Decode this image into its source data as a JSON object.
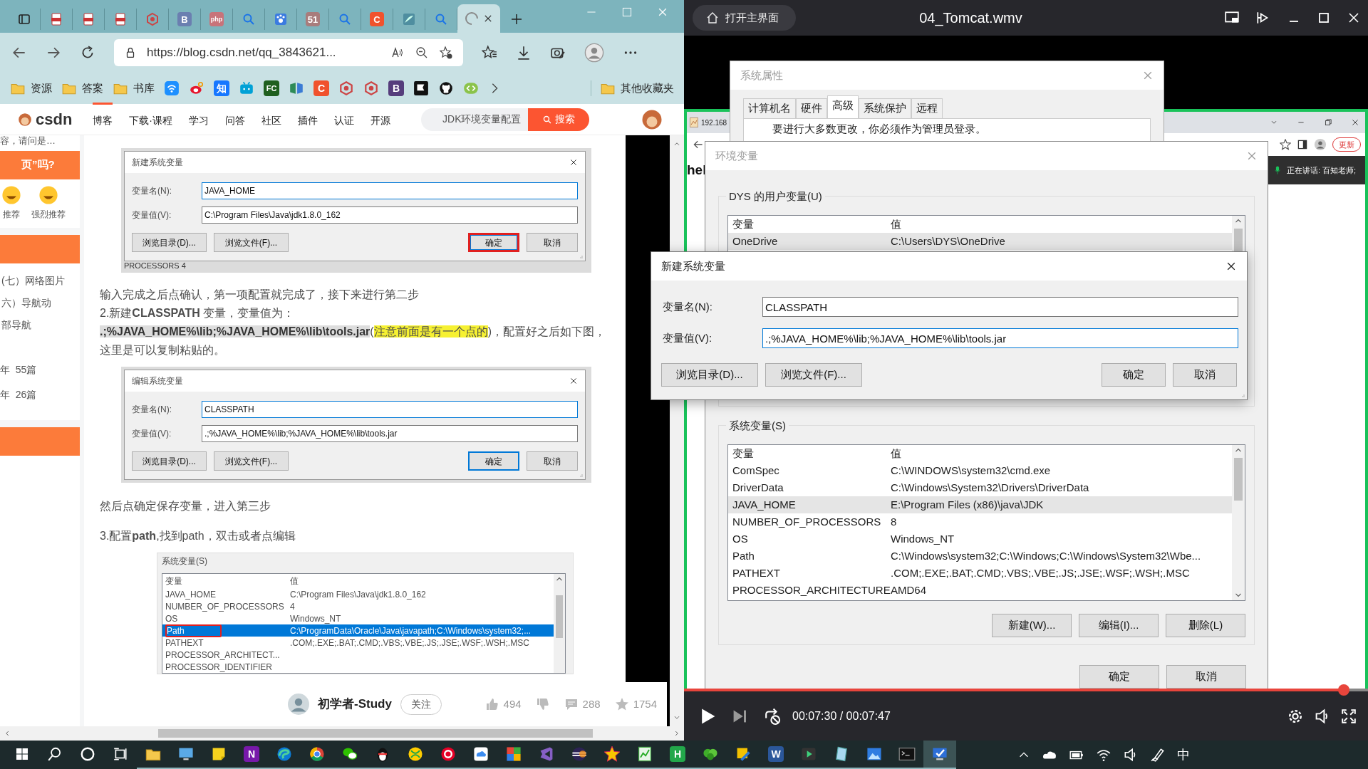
{
  "browser": {
    "tabs": [
      {
        "kind": "window",
        "selected": false
      },
      {
        "kind": "pdf",
        "selected": false
      },
      {
        "kind": "pdf",
        "selected": false
      },
      {
        "kind": "pdf",
        "selected": false
      },
      {
        "kind": "hexagon",
        "selected": false
      },
      {
        "kind": "letter",
        "glyph": "B",
        "color": "#6b7fb0",
        "selected": false
      },
      {
        "kind": "letter",
        "glyph": "php",
        "color": "#c8737a",
        "selected": false
      },
      {
        "kind": "search",
        "selected": false
      },
      {
        "kind": "paw",
        "selected": false
      },
      {
        "kind": "letter",
        "glyph": "51",
        "color": "#a87c7c",
        "selected": false
      },
      {
        "kind": "search",
        "selected": false
      },
      {
        "kind": "letter",
        "glyph": "C",
        "color": "#f0522d",
        "selected": false
      },
      {
        "kind": "leaf",
        "selected": false
      },
      {
        "kind": "search",
        "selected": false
      },
      {
        "kind": "loading",
        "selected": true
      }
    ],
    "address": "https://blog.csdn.net/qq_3843621...",
    "bookmarks": [
      {
        "kind": "folder",
        "label": "资源"
      },
      {
        "kind": "folder",
        "label": "答案"
      },
      {
        "kind": "folder",
        "label": "书库"
      },
      {
        "kind": "wifi"
      },
      {
        "kind": "eye"
      },
      {
        "kind": "letter",
        "glyph": "知",
        "color": "#1677ff"
      },
      {
        "kind": "tv"
      },
      {
        "kind": "letter",
        "glyph": "FC",
        "color": "#1f5f1f"
      },
      {
        "kind": "book"
      },
      {
        "kind": "letter",
        "glyph": "C",
        "color": "#f0522d"
      },
      {
        "kind": "hexagon"
      },
      {
        "kind": "hexagon"
      },
      {
        "kind": "letter",
        "glyph": "B",
        "color": "#563d7c"
      },
      {
        "kind": "flag"
      },
      {
        "kind": "cat"
      },
      {
        "kind": "code"
      }
    ],
    "other_bookmarks": "其他收藏夹"
  },
  "site": {
    "logo": "csdn",
    "nav": [
      {
        "label": "博客",
        "selected": true
      },
      {
        "label": "下载·课程",
        "selected": false
      },
      {
        "label": "学习",
        "selected": false
      },
      {
        "label": "问答",
        "selected": false
      },
      {
        "label": "社区",
        "selected": false
      },
      {
        "label": "插件",
        "selected": false
      },
      {
        "label": "认证",
        "selected": false
      },
      {
        "label": "开源",
        "selected": false
      }
    ],
    "search": {
      "placeholder": "JDK环境变量配置"
    },
    "search_button": "搜索"
  },
  "sidebar": {
    "question": "容，请问是…",
    "banner": "页”吗?",
    "reactions": [
      "推荐",
      "强烈推荐"
    ],
    "links": [
      "(七）网络图片",
      "六）导航动",
      "部导航"
    ],
    "archives": [
      "年  55篇",
      "年  26篇"
    ]
  },
  "article": {
    "blocks": [
      {
        "kind": "dialog",
        "title": "新建系统变量",
        "behind": "PROCESSORS  4",
        "fields": [
          {
            "label": "变量名(N):",
            "value": "JAVA_HOME",
            "focused": true
          },
          {
            "label": "变量值(V):",
            "value": "C:\\Program Files\\Java\\jdk1.8.0_162",
            "focused": false
          }
        ],
        "buttons": [
          {
            "label": "浏览目录(D)...",
            "default": false,
            "marked": false
          },
          {
            "label": "浏览文件(F)...",
            "default": false,
            "marked": false
          },
          {
            "label": "确定",
            "default": true,
            "marked": true
          },
          {
            "label": "取消",
            "default": false,
            "marked": false
          }
        ]
      },
      {
        "kind": "paragraph",
        "parts": [
          {
            "kind": "plain",
            "text": "输入完成之后点确认，第一项配置就完成了，接下来进行第二步"
          }
        ]
      },
      {
        "kind": "paragraph",
        "parts": [
          {
            "kind": "plain",
            "text": "2.新建**CLASSPATH** 变量，变量值为："
          }
        ]
      },
      {
        "kind": "paragraph",
        "parts": [
          {
            "kind": "code",
            "text": ".;%JAVA_HOME%\\lib;%JAVA_HOME%\\lib\\tools.jar"
          },
          {
            "kind": "plain",
            "text": "("
          },
          {
            "kind": "mark",
            "text": "注意前面是有一个点的"
          },
          {
            "kind": "plain",
            "text": ")，配置好之后如下图，这里是可以复制粘贴的。"
          }
        ]
      },
      {
        "kind": "dialog",
        "title": "编辑系统变量",
        "fields": [
          {
            "label": "变量名(N):",
            "value": "CLASSPATH",
            "focused": true
          },
          {
            "label": "变量值(V):",
            "value": ".;%JAVA_HOME%\\lib;%JAVA_HOME%\\lib\\tools.jar",
            "focused": false
          }
        ],
        "buttons": [
          {
            "label": "浏览目录(D)...",
            "default": false,
            "marked": false
          },
          {
            "label": "浏览文件(F)...",
            "default": false,
            "marked": false
          },
          {
            "label": "确定",
            "default": true,
            "marked": false
          },
          {
            "label": "取消",
            "default": false,
            "marked": false
          }
        ]
      },
      {
        "kind": "paragraph",
        "parts": [
          {
            "kind": "plain",
            "text": "然后点确定保存变量，进入第三步"
          }
        ]
      },
      {
        "kind": "paragraph",
        "parts": [
          {
            "kind": "plain",
            "text": "3.配置**path**,找到path，双击或者点编辑"
          }
        ]
      },
      {
        "kind": "variables",
        "group": "系统变量(S)",
        "columns": [
          "变量",
          "值"
        ],
        "rows": [
          {
            "name": "JAVA_HOME",
            "value": "C:\\Program Files\\Java\\jdk1.8.0_162",
            "selected": false,
            "marked": false
          },
          {
            "name": "NUMBER_OF_PROCESSORS",
            "value": "4",
            "selected": false,
            "marked": false
          },
          {
            "name": "OS",
            "value": "Windows_NT",
            "selected": false,
            "marked": false
          },
          {
            "name": "Path",
            "value": "C:\\ProgramData\\Oracle\\Java\\javapath;C:\\Windows\\system32;...",
            "selected": true,
            "marked": true
          },
          {
            "name": "PATHEXT",
            "value": ".COM;.EXE;.BAT;.CMD;.VBS;.VBE;.JS;.JSE;.WSF;.WSH;.MSC",
            "selected": false,
            "marked": false
          },
          {
            "name": "PROCESSOR_ARCHITECT...",
            "selected": false,
            "marked": false
          },
          {
            "name": "PROCESSOR_IDENTIFIER",
            "selected": false,
            "marked": false
          }
        ]
      }
    ],
    "author": {
      "name": "初学者-Study",
      "follow": "关注",
      "likes": "494",
      "comments": "288",
      "stars": "1754"
    }
  },
  "player": {
    "home": "打开主界面",
    "title": "04_Tomcat.wmv",
    "time": "00:07:30 / 00:07:47",
    "progress": {
      "level": 0.965
    },
    "video": {
      "browser": {
        "tab": "192.168",
        "heading": "hel",
        "speaking": "正在讲话: 百知老师;",
        "update": "更新"
      },
      "system_properties": {
        "title": "系统属性",
        "tabs": [
          {
            "label": "计算机名",
            "selected": false
          },
          {
            "label": "硬件",
            "selected": false
          },
          {
            "label": "高级",
            "selected": true
          },
          {
            "label": "系统保护",
            "selected": false
          },
          {
            "label": "远程",
            "selected": false
          }
        ],
        "notice": "要进行大多数更改，你必须作为管理员登录。"
      },
      "environment": {
        "title": "环境变量",
        "user_group": "DYS 的用户变量(U)",
        "user_columns": [
          "变量",
          "值"
        ],
        "user_rows": [
          {
            "name": "OneDrive",
            "value": "C:\\Users\\DYS\\OneDrive",
            "selected": true
          }
        ],
        "system_group": "系统变量(S)",
        "system_columns": [
          "变量",
          "值"
        ],
        "system_rows": [
          {
            "name": "ComSpec",
            "value": "C:\\WINDOWS\\system32\\cmd.exe",
            "selected": false
          },
          {
            "name": "DriverData",
            "value": "C:\\Windows\\System32\\Drivers\\DriverData",
            "selected": false
          },
          {
            "name": "JAVA_HOME",
            "value": "E:\\Program Files (x86)\\java\\JDK",
            "selected": true
          },
          {
            "name": "NUMBER_OF_PROCESSORS",
            "value": "8",
            "selected": false
          },
          {
            "name": "OS",
            "value": "Windows_NT",
            "selected": false
          },
          {
            "name": "Path",
            "value": "C:\\Windows\\system32;C:\\Windows;C:\\Windows\\System32\\Wbe...",
            "selected": false
          },
          {
            "name": "PATHEXT",
            "value": ".COM;.EXE;.BAT;.CMD;.VBS;.VBE;.JS;.JSE;.WSF;.WSH;.MSC",
            "selected": false
          },
          {
            "name": "PROCESSOR_ARCHITECTURE",
            "value": "AMD64",
            "selected": false
          }
        ],
        "group_buttons": [
          "新建(W)...",
          "编辑(I)...",
          "删除(L)"
        ],
        "buttons": [
          "确定",
          "取消"
        ]
      }
    }
  },
  "dialog": {
    "title": "新建系统变量",
    "fields": [
      {
        "label": "变量名(N):",
        "value": "CLASSPATH",
        "focused": false
      },
      {
        "label": "变量值(V):",
        "value": ".;%JAVA_HOME%\\lib;%JAVA_HOME%\\lib\\tools.jar",
        "focused": true
      }
    ],
    "buttons": [
      {
        "label": "浏览目录(D)...",
        "default": false,
        "marked": false
      },
      {
        "label": "浏览文件(F)...",
        "default": false,
        "marked": false
      },
      {
        "label": "确定",
        "default": false,
        "marked": false
      },
      {
        "label": "取消",
        "default": false,
        "marked": false
      }
    ]
  },
  "taskbar": {
    "apps": [
      {
        "kind": "folder",
        "running": true
      },
      {
        "kind": "monitor",
        "running": true
      },
      {
        "kind": "note",
        "running": true
      },
      {
        "kind": "letter",
        "glyph": "N",
        "color": "#7719aa",
        "running": true
      },
      {
        "kind": "swirl",
        "running": true
      },
      {
        "kind": "ring",
        "running": true
      },
      {
        "kind": "chat",
        "running": true
      },
      {
        "kind": "penguin",
        "running": true
      },
      {
        "kind": "ball",
        "running": true
      },
      {
        "kind": "target",
        "running": true
      },
      {
        "kind": "cloud",
        "running": true
      },
      {
        "kind": "grid",
        "running": true
      },
      {
        "kind": "ribbon",
        "running": true
      },
      {
        "kind": "eclipse",
        "running": true
      },
      {
        "kind": "star",
        "running": true
      },
      {
        "kind": "chart",
        "running": true
      },
      {
        "kind": "letter",
        "glyph": "H",
        "color": "#22a74a",
        "running": true
      },
      {
        "kind": "plant",
        "running": true
      },
      {
        "kind": "tools",
        "running": true
      },
      {
        "kind": "letter",
        "glyph": "W",
        "color": "#2b579a",
        "running": true
      },
      {
        "kind": "play",
        "running": true
      },
      {
        "kind": "tablet",
        "running": true
      },
      {
        "kind": "photo",
        "running": true
      },
      {
        "kind": "terminal",
        "running": true
      },
      {
        "kind": "screen",
        "running": true,
        "selected": true
      }
    ],
    "ime": "中"
  }
}
